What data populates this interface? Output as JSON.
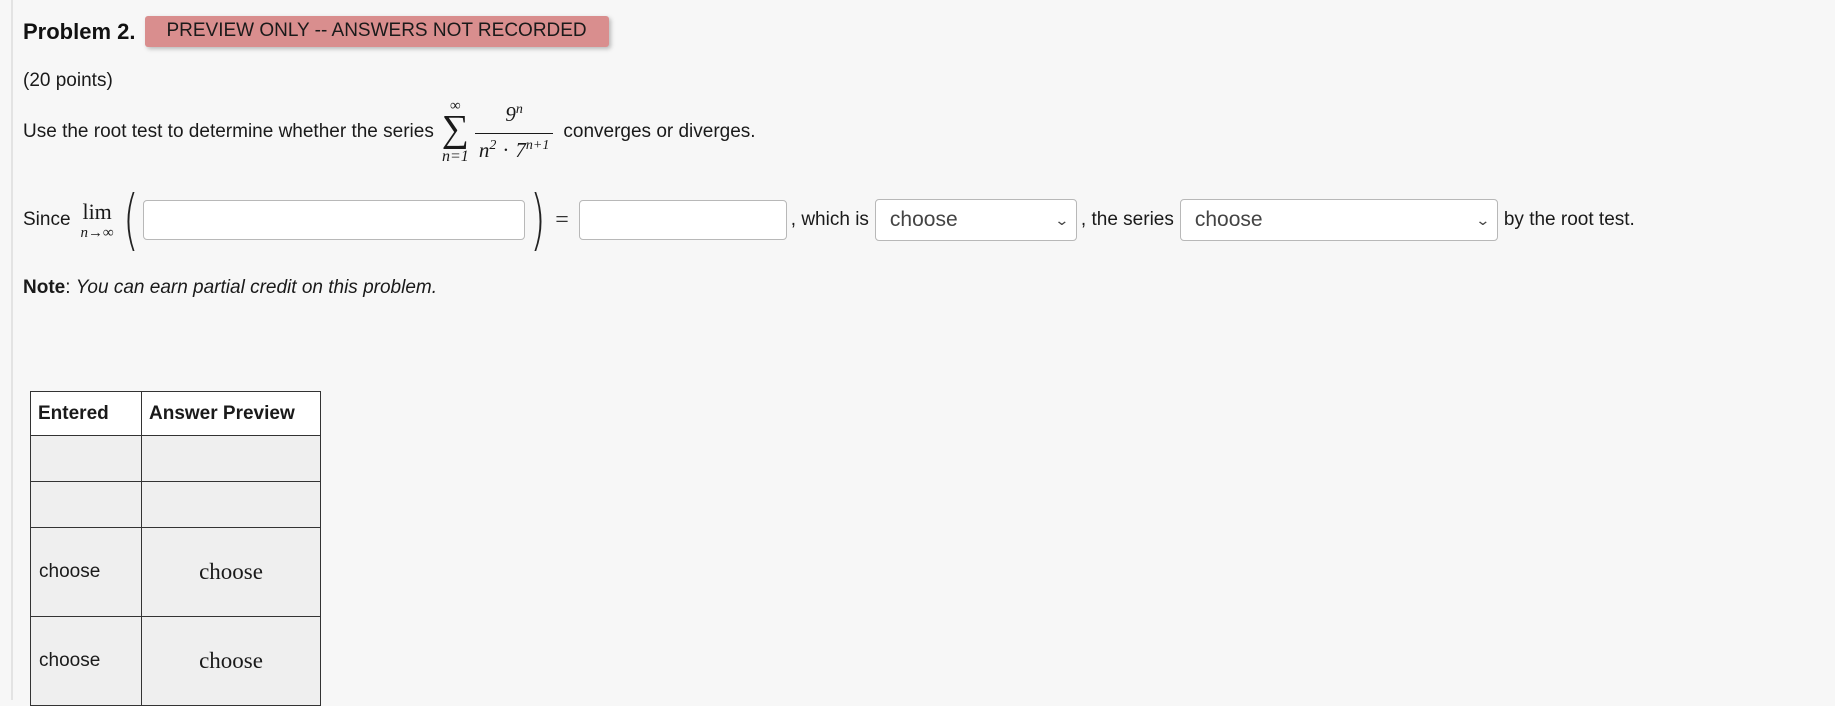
{
  "header": {
    "problem_title": "Problem 2.",
    "preview_badge": "PREVIEW ONLY -- ANSWERS NOT RECORDED"
  },
  "points": "(20 points)",
  "statement": {
    "prefix": "Use the root test to determine whether the series",
    "sum_upper": "∞",
    "sum_symbol": "∑",
    "sum_lower": "n=1",
    "numerator_base": "9",
    "numerator_exp": "n",
    "denominator_base1": "n",
    "denominator_exp1": "2",
    "denominator_dot": "·",
    "denominator_base2": "7",
    "denominator_exp2": "n+1",
    "suffix": "converges or diverges."
  },
  "answer_row": {
    "since": "Since",
    "lim_word": "lim",
    "lim_sub": "n→∞",
    "open_paren": "(",
    "close_paren": ")",
    "equals": "=",
    "expr_value": "",
    "limit_value": "",
    "which_is": ", which is",
    "compare_select": "choose",
    "the_series": ", the series",
    "result_select": "choose",
    "by_root_test": "by the root test."
  },
  "note": {
    "label": "Note",
    "separator": ": ",
    "text": "You can earn partial credit on this problem."
  },
  "answers_table": {
    "headers": [
      "Entered",
      "Answer Preview"
    ],
    "rows": [
      {
        "entered": "",
        "preview": ""
      },
      {
        "entered": "",
        "preview": ""
      },
      {
        "entered": "choose",
        "preview": "choose"
      },
      {
        "entered": "choose",
        "preview": "choose"
      }
    ]
  },
  "colors": {
    "badge_bg": "#d98e8e",
    "page_bg": "#f7f7f7",
    "cell_bg": "#efefef"
  },
  "icons": {
    "select_chevron": "chevron-down-icon"
  }
}
